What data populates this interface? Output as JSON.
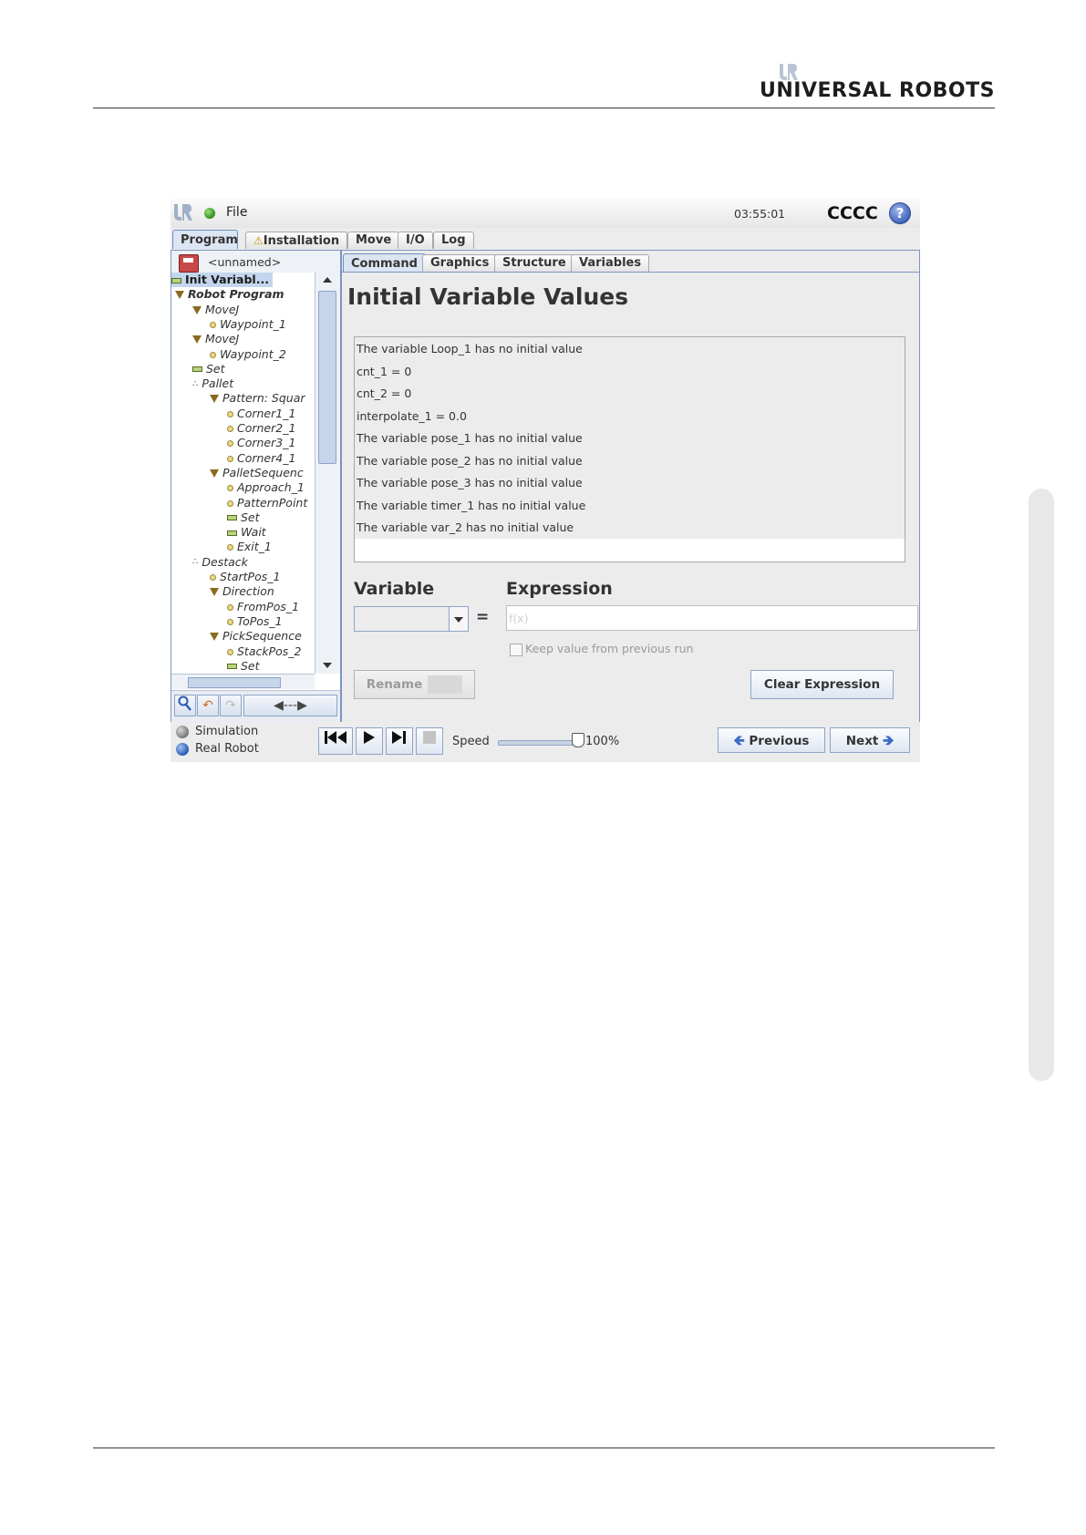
{
  "page": {
    "brand": "UNIVERSAL ROBOTS"
  },
  "topbar": {
    "file_label": "File",
    "clock": "03:55:01",
    "robot_name": "CCCC",
    "help_symbol": "?"
  },
  "main_tabs": [
    "Program",
    "Installation",
    "Move",
    "I/O",
    "Log"
  ],
  "program_name": "<unnamed>",
  "tree": [
    {
      "label": "Init Variabl...",
      "icon": "bar-icon",
      "selected": true
    },
    {
      "label": "Robot Program",
      "icon": "triangle-icon"
    },
    {
      "label": "MoveJ",
      "icon": "triangle-icon"
    },
    {
      "label": "Waypoint_1",
      "icon": "waypoint-icon"
    },
    {
      "label": "MoveJ",
      "icon": "triangle-icon"
    },
    {
      "label": "Waypoint_2",
      "icon": "waypoint-icon"
    },
    {
      "label": "Set",
      "icon": "bar-icon"
    },
    {
      "label": "Pallet",
      "icon": "pallet-icon"
    },
    {
      "label": "Pattern: Squar",
      "icon": "triangle-icon"
    },
    {
      "label": "Corner1_1",
      "icon": "waypoint-icon"
    },
    {
      "label": "Corner2_1",
      "icon": "waypoint-icon"
    },
    {
      "label": "Corner3_1",
      "icon": "waypoint-icon"
    },
    {
      "label": "Corner4_1",
      "icon": "waypoint-icon"
    },
    {
      "label": "PalletSequenc",
      "icon": "triangle-icon"
    },
    {
      "label": "Approach_1",
      "icon": "waypoint-icon"
    },
    {
      "label": "PatternPoint",
      "icon": "waypoint-icon"
    },
    {
      "label": "Set",
      "icon": "bar-icon"
    },
    {
      "label": "Wait",
      "icon": "bar-icon"
    },
    {
      "label": "Exit_1",
      "icon": "waypoint-icon"
    },
    {
      "label": "Destack",
      "icon": "pallet-icon"
    },
    {
      "label": "StartPos_1",
      "icon": "waypoint-icon"
    },
    {
      "label": "Direction",
      "icon": "triangle-icon"
    },
    {
      "label": "FromPos_1",
      "icon": "waypoint-icon"
    },
    {
      "label": "ToPos_1",
      "icon": "waypoint-icon"
    },
    {
      "label": "PickSequence",
      "icon": "triangle-icon"
    },
    {
      "label": "StackPos_2",
      "icon": "waypoint-icon"
    },
    {
      "label": "Set",
      "icon": "bar-icon"
    }
  ],
  "sub_tabs": [
    "Command",
    "Graphics",
    "Structure",
    "Variables"
  ],
  "content": {
    "title": "Initial Variable Values",
    "variables": [
      "The variable Loop_1 has no initial value",
      "cnt_1 = 0",
      "cnt_2 = 0",
      "interpolate_1 = 0.0",
      "The variable pose_1 has no initial value",
      "The variable pose_2 has no initial value",
      "The variable pose_3 has no initial value",
      "The variable timer_1 has no initial value",
      "The variable var_2 has no initial value"
    ],
    "variable_label": "Variable",
    "expression_label": "Expression",
    "equals": "=",
    "expression_placeholder": "f(x)",
    "keep_value_label": "Keep value from previous run",
    "rename_label": "Rename",
    "clear_label": "Clear Expression"
  },
  "bottom": {
    "simulation_label": "Simulation",
    "real_robot_label": "Real Robot",
    "speed_label": "Speed",
    "speed_value": "100%",
    "speed_fraction": 1.0,
    "previous_label": "Previous",
    "next_label": "Next"
  },
  "colors": {
    "accent": "#7c95c2",
    "selection": "#c4d6ee",
    "status_dot": "#2e8b1c"
  }
}
